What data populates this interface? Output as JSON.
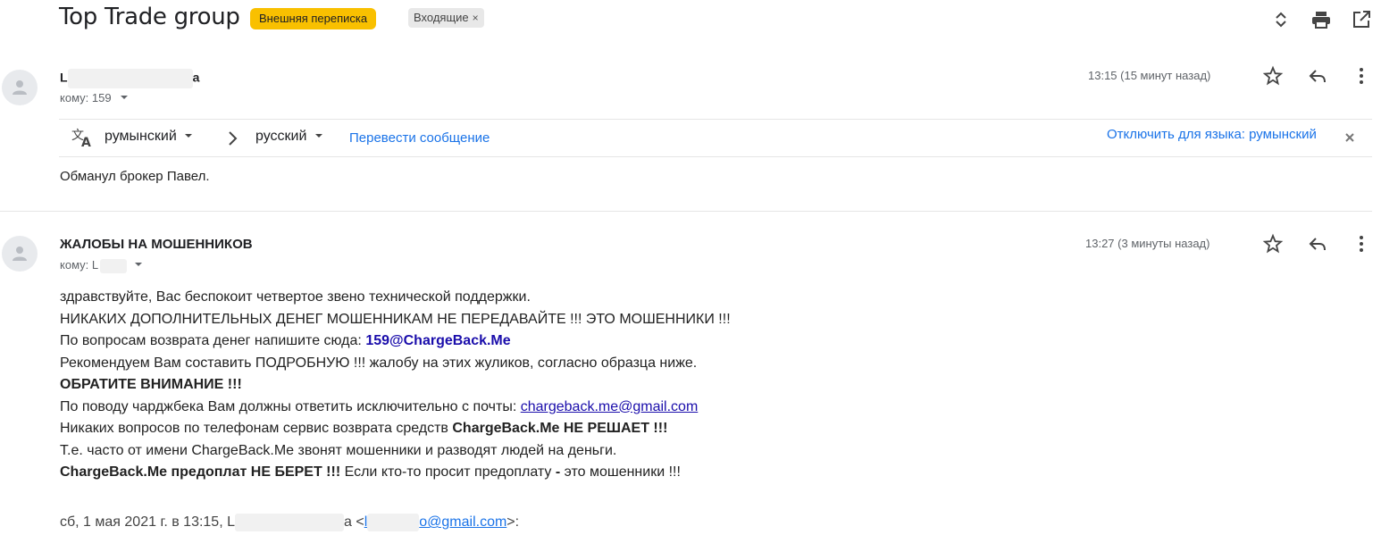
{
  "header": {
    "subject": "Top Trade group",
    "label_external": "Внешняя переписка",
    "label_inbox": "Входящие",
    "label_remove": "×",
    "icons": [
      "expand-collapse-icon",
      "print-icon",
      "open-new-window-icon"
    ]
  },
  "message1": {
    "sender_prefix": "L",
    "sender_suffix": "a",
    "to_label": "кому: 159",
    "time": "13:15 (15 минут назад)",
    "translate": {
      "from_lang": "румынский",
      "to_lang": "русский",
      "translate_link": "Перевести сообщение",
      "disable_link": "Отключить для языка: румынский"
    },
    "body": "Обманул брокер Павел."
  },
  "message2": {
    "sender": "ЖАЛОБЫ НА МОШЕННИКОВ",
    "to_label": "кому: L",
    "time": "13:27 (3 минуты назад)",
    "lines": {
      "l1": "здравствуйте, Вас беспокоит четвертое звено технической поддержки.",
      "l2": "НИКАКИХ ДОПОЛНИТЕЛЬНЫХ ДЕНЕГ МОШЕННИКАМ НЕ ПЕРЕДАВАЙТЕ !!! ЭТО МОШЕННИКИ !!!",
      "l3_text": "По вопросам возврата денег напишите сюда: ",
      "l3_email": "159@ChargeBack.Me",
      "l4": "Рекомендуем Вам составить ПОДРОБНУЮ !!! жалобу на этих жуликов, согласно образца ниже.",
      "l5": "ОБРАТИТЕ ВНИМАНИЕ !!!",
      "l6_text": "По поводу чарджбека Вам должны ответить исключительно с почты: ",
      "l6_email": "chargeback.me@gmail.com",
      "l7_text": "Никаких вопросов по телефонам сервис возврата средств ",
      "l7_bold": "ChargeBack.Me НЕ РЕШАЕТ !!!",
      "l8": "Т.е. часто от имени ChargeBack.Me звонят мошенники и разводят людей на деньги.",
      "l9_bold": "ChargeBack.Me предоплат НЕ БЕРЕТ !!!",
      "l9_text": " Если кто-то просит предоплату ",
      "l9_dash": "-",
      "l9_end": " это мошенники !!!"
    },
    "quote": {
      "prefix": "сб, 1 мая 2021 г. в 13:15, L",
      "mid": "a <",
      "email_start": "l",
      "email_end": "o@gmail.com",
      "suffix": ">:"
    }
  },
  "colors": {
    "label_yellow": "#f9c000",
    "link_blue": "#1a73e8",
    "dark_link": "#1a0dab"
  }
}
